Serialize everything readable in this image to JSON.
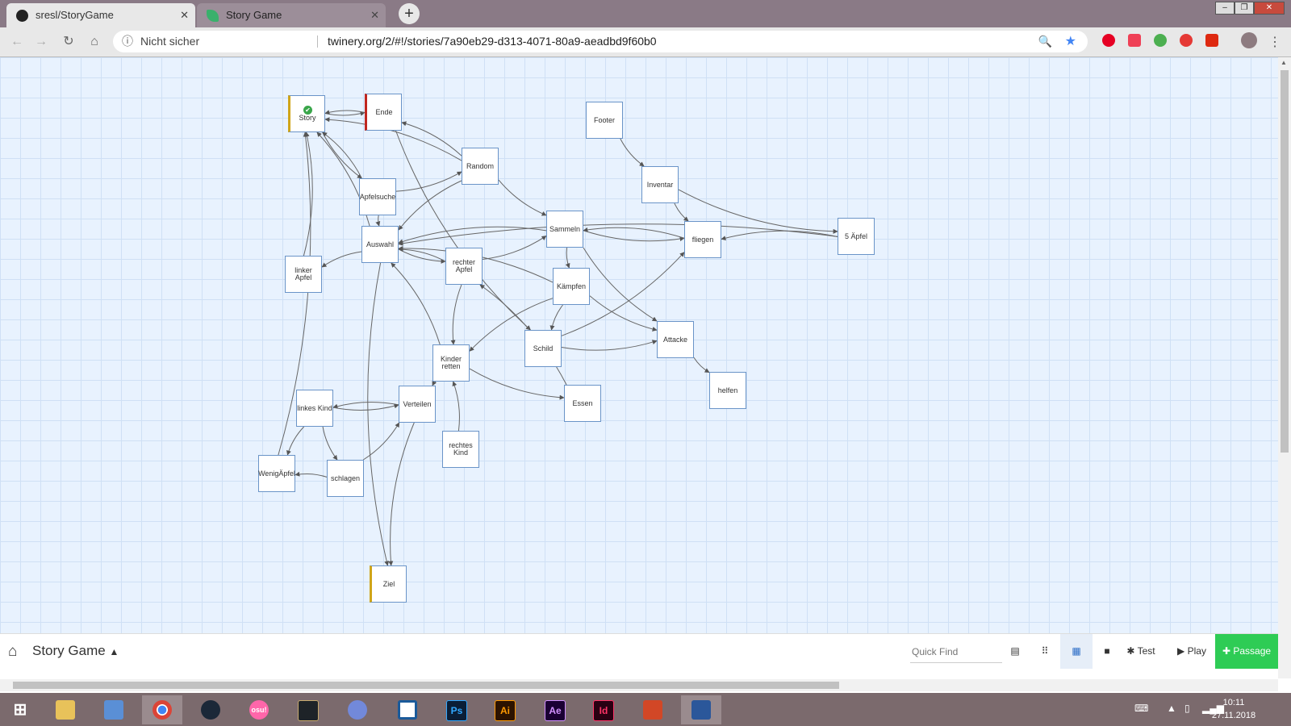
{
  "browser": {
    "tabs": [
      {
        "title": "sresl/StoryGame",
        "active": true,
        "icon": "github-icon"
      },
      {
        "title": "Story Game",
        "active": false,
        "icon": "twine-icon"
      }
    ],
    "security_label": "Nicht sicher",
    "url": "twinery.org/2/#!/stories/7a90eb29-d313-4071-80a9-aeadbd9f60b0",
    "extensions": [
      "pinterest-icon",
      "pocket-icon",
      "ext-green-icon",
      "ext-red-icon",
      "ext-flag-icon"
    ]
  },
  "story": {
    "name": "Story Game",
    "passages": [
      {
        "id": "story",
        "label": "Story",
        "tag": "yellow",
        "start": true
      },
      {
        "id": "ende",
        "label": "Ende",
        "tag": "red"
      },
      {
        "id": "footer",
        "label": "Footer"
      },
      {
        "id": "random",
        "label": "Random"
      },
      {
        "id": "inventar",
        "label": "Inventar"
      },
      {
        "id": "apfelsuche",
        "label": "Apfelsuche"
      },
      {
        "id": "sammeln",
        "label": "Sammeln"
      },
      {
        "id": "fliegen",
        "label": "fliegen"
      },
      {
        "id": "5apfel",
        "label": "5 Äpfel"
      },
      {
        "id": "auswahl",
        "label": "Auswahl"
      },
      {
        "id": "linkerapfel",
        "label": "linker Apfel"
      },
      {
        "id": "rechterapfel",
        "label": "rechter Apfel"
      },
      {
        "id": "kampfen",
        "label": "Kämpfen"
      },
      {
        "id": "attacke",
        "label": "Attacke"
      },
      {
        "id": "schild",
        "label": "Schild"
      },
      {
        "id": "kinderretten",
        "label": "Kinder retten"
      },
      {
        "id": "helfen",
        "label": "helfen"
      },
      {
        "id": "essen",
        "label": "Essen"
      },
      {
        "id": "linkeskind",
        "label": "linkes Kind"
      },
      {
        "id": "verteilen",
        "label": "Verteilen"
      },
      {
        "id": "rechteskind",
        "label": "rechtes Kind"
      },
      {
        "id": "wenigapfel",
        "label": "WenigÄpfel"
      },
      {
        "id": "schlagen",
        "label": "schlagen"
      },
      {
        "id": "ziel",
        "label": "Ziel",
        "tag": "yellow"
      }
    ],
    "links": [
      [
        "story",
        "ende"
      ],
      [
        "ende",
        "story"
      ],
      [
        "random",
        "ende"
      ],
      [
        "random",
        "story"
      ],
      [
        "random",
        "sammeln"
      ],
      [
        "random",
        "auswahl"
      ],
      [
        "apfelsuche",
        "random"
      ],
      [
        "story",
        "apfelsuche"
      ],
      [
        "apfelsuche",
        "story"
      ],
      [
        "apfelsuche",
        "auswahl"
      ],
      [
        "footer",
        "inventar"
      ],
      [
        "inventar",
        "5apfel"
      ],
      [
        "inventar",
        "fliegen"
      ],
      [
        "sammeln",
        "fliegen"
      ],
      [
        "sammeln",
        "auswahl"
      ],
      [
        "sammeln",
        "kampfen"
      ],
      [
        "sammeln",
        "attacke"
      ],
      [
        "fliegen",
        "sammeln"
      ],
      [
        "5apfel",
        "fliegen"
      ],
      [
        "5apfel",
        "auswahl"
      ],
      [
        "auswahl",
        "linkerapfel"
      ],
      [
        "auswahl",
        "rechterapfel"
      ],
      [
        "auswahl",
        "story"
      ],
      [
        "auswahl",
        "ziel"
      ],
      [
        "linkerapfel",
        "story"
      ],
      [
        "rechterapfel",
        "auswahl"
      ],
      [
        "rechterapfel",
        "sammeln"
      ],
      [
        "rechterapfel",
        "kinderretten"
      ],
      [
        "kampfen",
        "auswahl"
      ],
      [
        "kampfen",
        "attacke"
      ],
      [
        "kampfen",
        "schild"
      ],
      [
        "kampfen",
        "kinderretten"
      ],
      [
        "schild",
        "attacke"
      ],
      [
        "schild",
        "fliegen"
      ],
      [
        "attacke",
        "helfen"
      ],
      [
        "ende",
        "schild"
      ],
      [
        "kinderretten",
        "auswahl"
      ],
      [
        "kinderretten",
        "essen"
      ],
      [
        "kinderretten",
        "verteilen"
      ],
      [
        "verteilen",
        "linkeskind"
      ],
      [
        "linkeskind",
        "verteilen"
      ],
      [
        "linkeskind",
        "wenigapfel"
      ],
      [
        "linkeskind",
        "schlagen"
      ],
      [
        "schlagen",
        "wenigapfel"
      ],
      [
        "schlagen",
        "verteilen"
      ],
      [
        "wenigapfel",
        "story"
      ],
      [
        "verteilen",
        "ziel"
      ],
      [
        "rechteskind",
        "kinderretten"
      ],
      [
        "essen",
        "rechterapfel"
      ]
    ]
  },
  "storybar": {
    "quick_find_placeholder": "Quick Find",
    "test_label": "Test",
    "play_label": "Play",
    "passage_label": "Passage"
  },
  "taskbar": {
    "apps": [
      "start-icon",
      "explorer-icon",
      "control-panel-icon",
      "chrome-icon",
      "steam-icon",
      "osu-icon",
      "league-icon",
      "discord-icon",
      "clipboard-icon",
      "photoshop-icon",
      "illustrator-icon",
      "after-effects-icon",
      "indesign-icon",
      "powerpoint-icon",
      "word-icon"
    ],
    "osu_label": "osu!",
    "ps_label": "Ps",
    "ai_label": "Ai",
    "ae_label": "Ae",
    "id_label": "Id",
    "time": "10:11",
    "date": "27.11.2018"
  }
}
